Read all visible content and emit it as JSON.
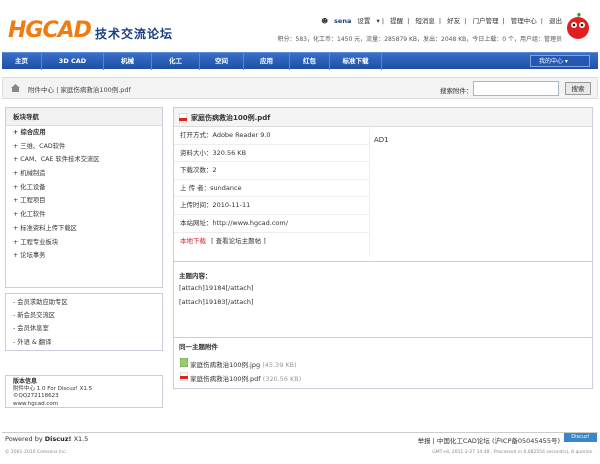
{
  "header": {
    "logo_text": "HGCAD",
    "logo_cn": "技术交流论坛",
    "user": "sena",
    "user_links": [
      "设置",
      "提醒",
      "短消息",
      "好友",
      "门户管理",
      "管理中心",
      "退出"
    ],
    "stats": "积分：583，化工币：1450 元，流量：285879 KB，发出：2048 KB，今日上载：0 个，用户组：管理员"
  },
  "nav": {
    "items": [
      "主页",
      "3D CAD",
      "机械",
      "化工",
      "空间",
      "应用",
      "红包",
      "标准下载"
    ],
    "my_center": "我的中心"
  },
  "breadcrumb": {
    "path": "附件中心 | 家庭伤病救治100例.pdf",
    "search_label": "搜索附件：",
    "search_placeholder": "",
    "search_button": "搜索"
  },
  "sidebar": {
    "nav_title": "板块导航",
    "nav_items": [
      "+ 综合应用",
      "+ 三维、CAD软件",
      "+ CAM、CAE 软件技术交流区",
      "+ 机械制造",
      "+ 化工设备",
      "+ 工程项目",
      "+ 化工软件",
      "+ 标准资料上传下载区",
      "+ 工程专业板块",
      "+ 论坛事务"
    ],
    "extra_items": [
      "- 会员求助应助专区",
      "- 新会员交流区",
      "- 会员休息室",
      "- 外语 & 翻译"
    ],
    "version_title": "版本信息",
    "version_lines": [
      "附件中心 1.0 For Discuz! X1.5",
      "©QQ272118623",
      "www.hgcad.com"
    ]
  },
  "main": {
    "file_title": "家庭伤病救治100例.pdf",
    "info": [
      {
        "label": "打开方式：",
        "value": "Adobe Reader 9.0"
      },
      {
        "label": "资料大小：",
        "value": "320.56 KB"
      },
      {
        "label": "下载次数：",
        "value": "2"
      },
      {
        "label": "上 传 者：",
        "value": "sundance"
      },
      {
        "label": "上传时间：",
        "value": "2010-11-11"
      },
      {
        "label": "本站网址：",
        "value": "http://www.hgcad.com/"
      }
    ],
    "download_label": "本地下载",
    "download_link": "[ 查看论坛主题帖 ]",
    "ad": "AD1",
    "content_title": "主题内容：",
    "attach_lines": [
      "[attach]19184[/attach]",
      "[attach]19183[/attach]"
    ],
    "same_title": "同一主题附件",
    "same_files": [
      {
        "name": "家庭伤病救治100例.jpg",
        "size": "(45.39 KB)"
      },
      {
        "name": "家庭伤病救治100例.pdf",
        "size": "(320.56 KB)"
      }
    ]
  },
  "footer": {
    "powered": "Powered by",
    "brand": "Discuz!",
    "version": "X1.5",
    "copyright": "© 2001-2010 Comsenz Inc.",
    "links": "举报 | 中国化工CAD论坛 (沪ICP备05045455号)",
    "logo_badge": "Discuz!",
    "gmt": "GMT+8, 2011-2-27 14:48 , Processed in 0.082554 second(s), 8 queries ."
  },
  "colors": {
    "nav": "#1d4fa6",
    "logo": "#f07b10",
    "accent": "#1a3e87"
  }
}
